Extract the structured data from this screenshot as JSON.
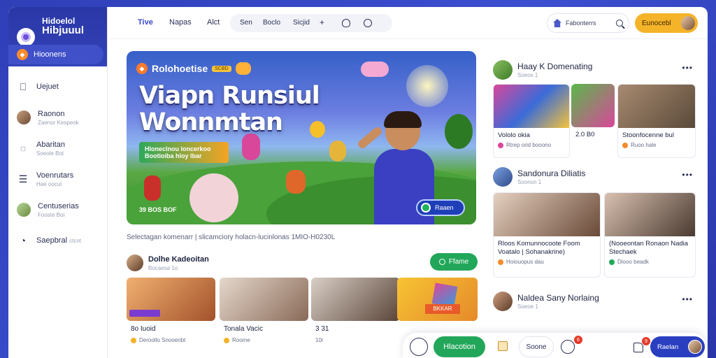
{
  "brand": {
    "line1": "Hidoelol",
    "line2": "Hibjuuul"
  },
  "sidebar": {
    "active": {
      "label": "Hioonens",
      "icon": "flame-icon"
    },
    "items": [
      {
        "title": "Uejuet",
        "sub": "",
        "icon": "bookmark-icon"
      },
      {
        "title": "Raonon",
        "sub": "Zaenor Kespeok",
        "icon": "avatar"
      },
      {
        "title": "Abaritan",
        "sub": "Soeole Bot",
        "icon": "chat-icon"
      },
      {
        "title": "Voenrutars",
        "sub": "Hae oocul",
        "icon": "list-icon"
      },
      {
        "title": "Centuserias",
        "sub": "Fooste Boi",
        "icon": "avatar"
      },
      {
        "title": "Saepbral",
        "sub": "ctcnt",
        "icon": "comment-icon"
      }
    ]
  },
  "topnav": {
    "links": [
      "Tive",
      "Napas",
      "Alct"
    ],
    "pills": [
      "Sen",
      "Boclo",
      "Sicjid",
      "+"
    ],
    "search_text": "Fabonterrs",
    "user_label": "Eunocebl"
  },
  "hero": {
    "badge_title": "Rolohoetise",
    "badge_tag": "SCBD",
    "title_line1": "Viapn Runsiul",
    "title_line2": "Wonnmtan",
    "tag_line1": "Hloneclnou loncerkoo",
    "tag_line2": "Bootioiba hloy lbar",
    "time": "39 BOS BOF",
    "cta_label": "Raaen"
  },
  "caption": "Selectagan komenarr | slicamciory holacn-lucinlonas 1MIO-H0230L",
  "channel": {
    "name": "Dolhe Kadeoitan",
    "sub": "Bocaesa 1o",
    "button": "Ffame"
  },
  "video_row": [
    {
      "title": "8o Iuoid",
      "meta": "Deroollo Snooenbt"
    },
    {
      "title": "Tonala Vacic",
      "meta": "Roome"
    },
    {
      "title": "3 31",
      "meta": "10r"
    },
    {
      "title": "",
      "meta": "",
      "label": "BKKAR"
    }
  ],
  "right": [
    {
      "name": "Haay K Domenating",
      "sub": "Soeos 1",
      "cards": [
        {
          "title": "Vololo okia",
          "meta": "Rtrep orid booono"
        },
        {
          "title": "2.0 B0",
          "meta": ""
        },
        {
          "title": "Stoonfocenne bul",
          "meta": "Ruoo hale"
        }
      ]
    },
    {
      "name": "Sandonura Diliatis",
      "sub": "Soonon 1",
      "cards": [
        {
          "title": "Rloos Komunnocoote Foom Voatalo | Sohanakrine)",
          "meta": "Hoiouopus dau"
        },
        {
          "title": "(Nooeontan Ronaon Nadia Stechaek",
          "meta": "Diooo beadk"
        }
      ]
    },
    {
      "name": "Naldea Sany Norlaing",
      "sub": "Soeoe 1",
      "cards": []
    }
  ],
  "bottombar": {
    "primary": "Hlacotion",
    "secondary": "Soone",
    "badge1": "6",
    "badge2": "9",
    "user": "Raelan"
  }
}
